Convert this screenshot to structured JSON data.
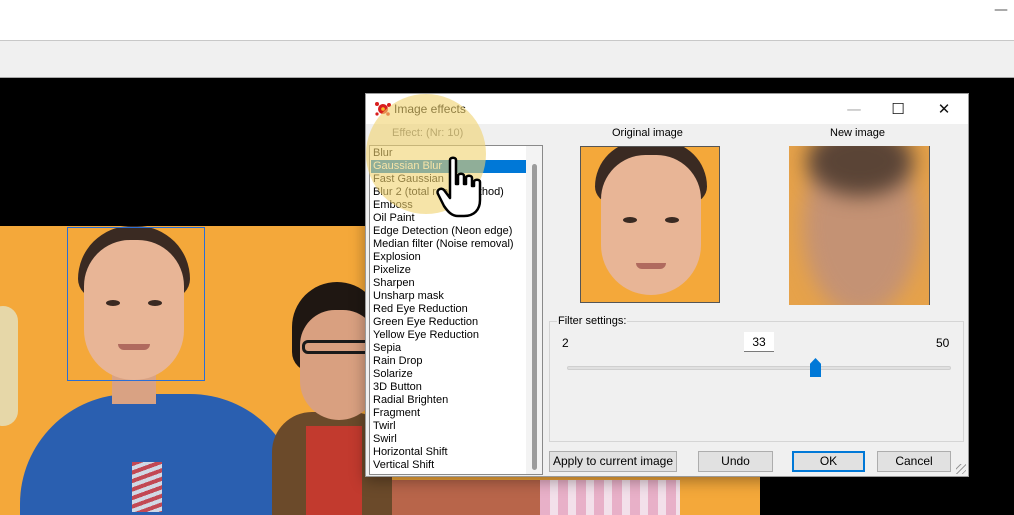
{
  "dialog": {
    "title": "Image effects",
    "effect_label": "Effect:    (Nr: 10)",
    "original_image_label": "Original image",
    "new_image_label": "New image",
    "effects": [
      "Blur",
      "Gaussian Blur",
      "Fast Gaussian",
      "Blur 2 (total range method)",
      "Emboss",
      "Oil Paint",
      "Edge Detection (Neon edge)",
      "Median filter (Noise removal)",
      "Explosion",
      "Pixelize",
      "Sharpen",
      "Unsharp mask",
      "Red Eye Reduction",
      "Green Eye Reduction",
      "Yellow Eye Reduction",
      "Sepia",
      "Rain Drop",
      "Solarize",
      "3D Button",
      "Radial Brighten",
      "Fragment",
      "Twirl",
      "Swirl",
      "Horizontal Shift",
      "Vertical Shift"
    ],
    "selected_effect": "Gaussian Blur",
    "filter_settings": {
      "label": "Filter settings:",
      "min": "2",
      "max": "50",
      "value": "33"
    },
    "buttons": {
      "apply": "Apply to current image",
      "undo": "Undo",
      "ok": "OK",
      "cancel": "Cancel"
    },
    "controls": {
      "minimize": "—",
      "maximize": "☐",
      "close": "✕"
    }
  },
  "app": {
    "minimize": "—"
  },
  "colors": {
    "accent": "#0078d7",
    "photo_background": "#f4a83a",
    "cursor_highlight": "#f0d26e"
  },
  "icons": {
    "app_icon": "red-splat-icon",
    "cursor": "hand-pointer-icon"
  }
}
